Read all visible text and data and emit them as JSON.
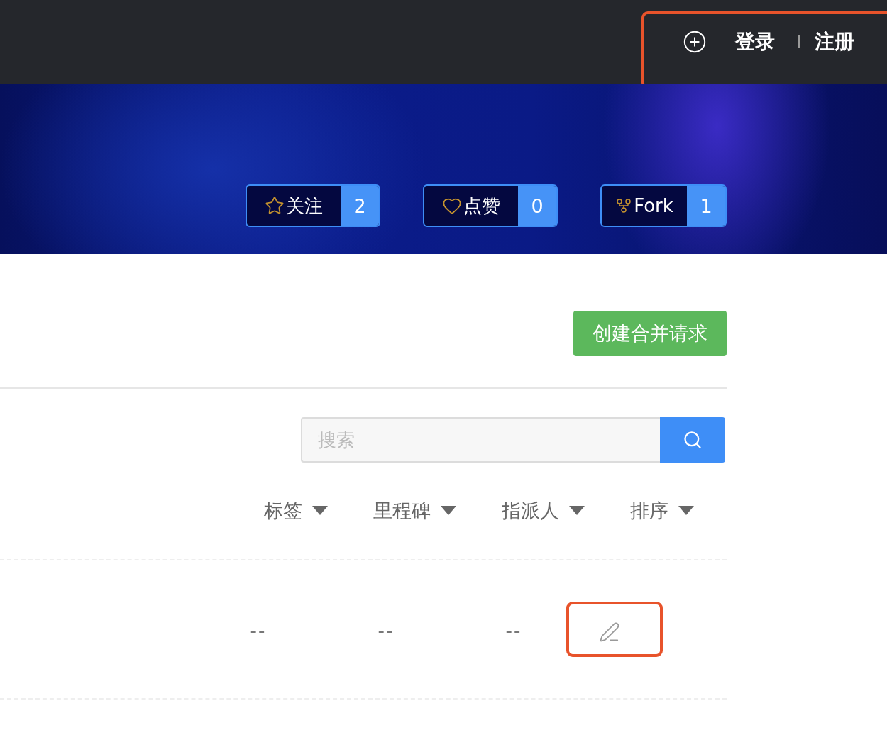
{
  "header": {
    "highlighted": true,
    "links": [
      {
        "label": "登录"
      },
      {
        "label": "注册"
      }
    ]
  },
  "stats": [
    {
      "kind": "star",
      "label": "关注",
      "count": "2"
    },
    {
      "kind": "heart",
      "label": "点赞",
      "count": "0"
    },
    {
      "kind": "fork",
      "label": "Fork",
      "count": "1"
    }
  ],
  "create_button": "创建合并请求",
  "search": {
    "placeholder": "搜索"
  },
  "filters": [
    {
      "label": "标签"
    },
    {
      "label": "里程碑"
    },
    {
      "label": "指派人"
    },
    {
      "label": "排序"
    }
  ],
  "rows": [
    {
      "cells": [
        "--",
        "--",
        "--"
      ],
      "edit_highlighted": true
    }
  ]
}
